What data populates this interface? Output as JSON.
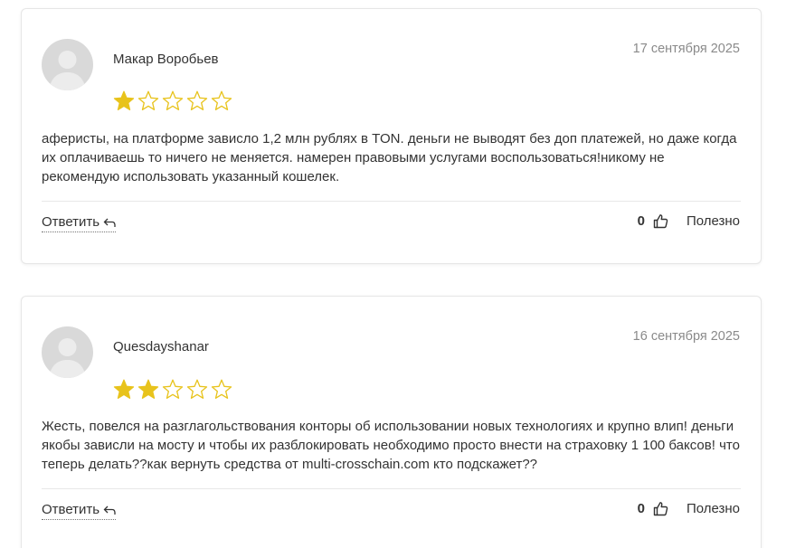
{
  "colors": {
    "star_filled": "#e8c31c",
    "star_empty_outline": "#e8c31c",
    "avatar_bg": "#d9d9d9",
    "date_text": "#8a8a8a"
  },
  "reviews": [
    {
      "author": "Макар Воробьев",
      "date": "17 сентября 2025",
      "rating": 1,
      "max_rating": 5,
      "text": "аферисты, на платформе зависло 1,2 млн рублях в TON. деньги не выводят без доп платежей, но даже когда их оплачиваешь то ничего не меняется. намерен правовыми услугами воспользоваться!никому не рекомендую использовать указанный кошелек.",
      "reply_label": "Ответить",
      "reply_icon": "reply-arrow-icon",
      "helpful_count": "0",
      "like_icon": "thumbs-up-icon",
      "helpful_label": "Полезно"
    },
    {
      "author": "Quesdayshanar",
      "date": "16 сентября 2025",
      "rating": 2,
      "max_rating": 5,
      "text": "Жесть, повелся на разглагольствования конторы об использовании новых технологиях и крупно влип! деньги якобы зависли на мосту и чтобы их разблокировать необходимо просто внести на страховку 1 100 баксов! что теперь делать??как вернуть средства от multi-crosschain.com кто подскажет??",
      "reply_label": "Ответить",
      "reply_icon": "reply-arrow-icon",
      "helpful_count": "0",
      "like_icon": "thumbs-up-icon",
      "helpful_label": "Полезно"
    }
  ]
}
